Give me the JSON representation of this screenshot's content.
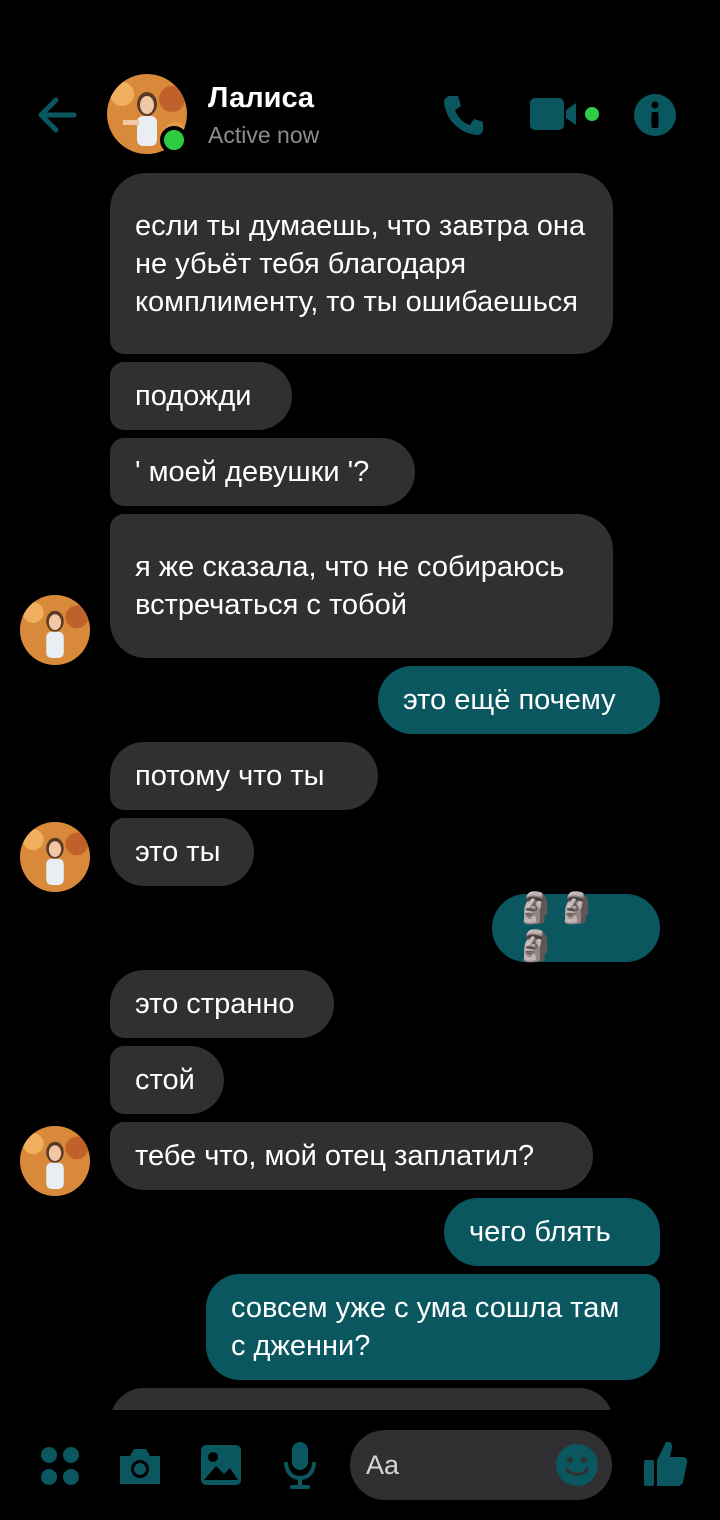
{
  "header": {
    "contact_name": "Лалиса",
    "status": "Active now"
  },
  "messages": [
    {
      "dir": "in",
      "text": "если ты думаешь, что завтра она не убьёт тебя благодаря комплименту, то ты ошибаешься"
    },
    {
      "dir": "in",
      "text": "подожди"
    },
    {
      "dir": "in",
      "text": "' моей девушки '?"
    },
    {
      "dir": "in",
      "text": "я же сказала, что не собираюсь встречаться с тобой"
    },
    {
      "dir": "out",
      "text": "это ещё почему"
    },
    {
      "dir": "in",
      "text": "потому что ты"
    },
    {
      "dir": "in",
      "text": "это ты"
    },
    {
      "dir": "out",
      "text": "🗿🗿🗿"
    },
    {
      "dir": "in",
      "text": "это странно"
    },
    {
      "dir": "in",
      "text": "стой"
    },
    {
      "dir": "in",
      "text": "тебе что, мой отец заплатил?"
    },
    {
      "dir": "out",
      "text": "чего блять"
    },
    {
      "dir": "out",
      "text": "совсем уже с ума сошла там с дженни?"
    }
  ],
  "composer": {
    "placeholder": "Aa"
  },
  "colors": {
    "accent": "#0a5760",
    "incoming_bubble": "#303033",
    "outgoing_bubble": "#0a5760",
    "online": "#2ecc40"
  },
  "icons": [
    "back-arrow-icon",
    "phone-icon",
    "video-icon",
    "info-icon",
    "apps-icon",
    "camera-icon",
    "gallery-icon",
    "microphone-icon",
    "emoji-icon",
    "thumbs-up-icon"
  ]
}
